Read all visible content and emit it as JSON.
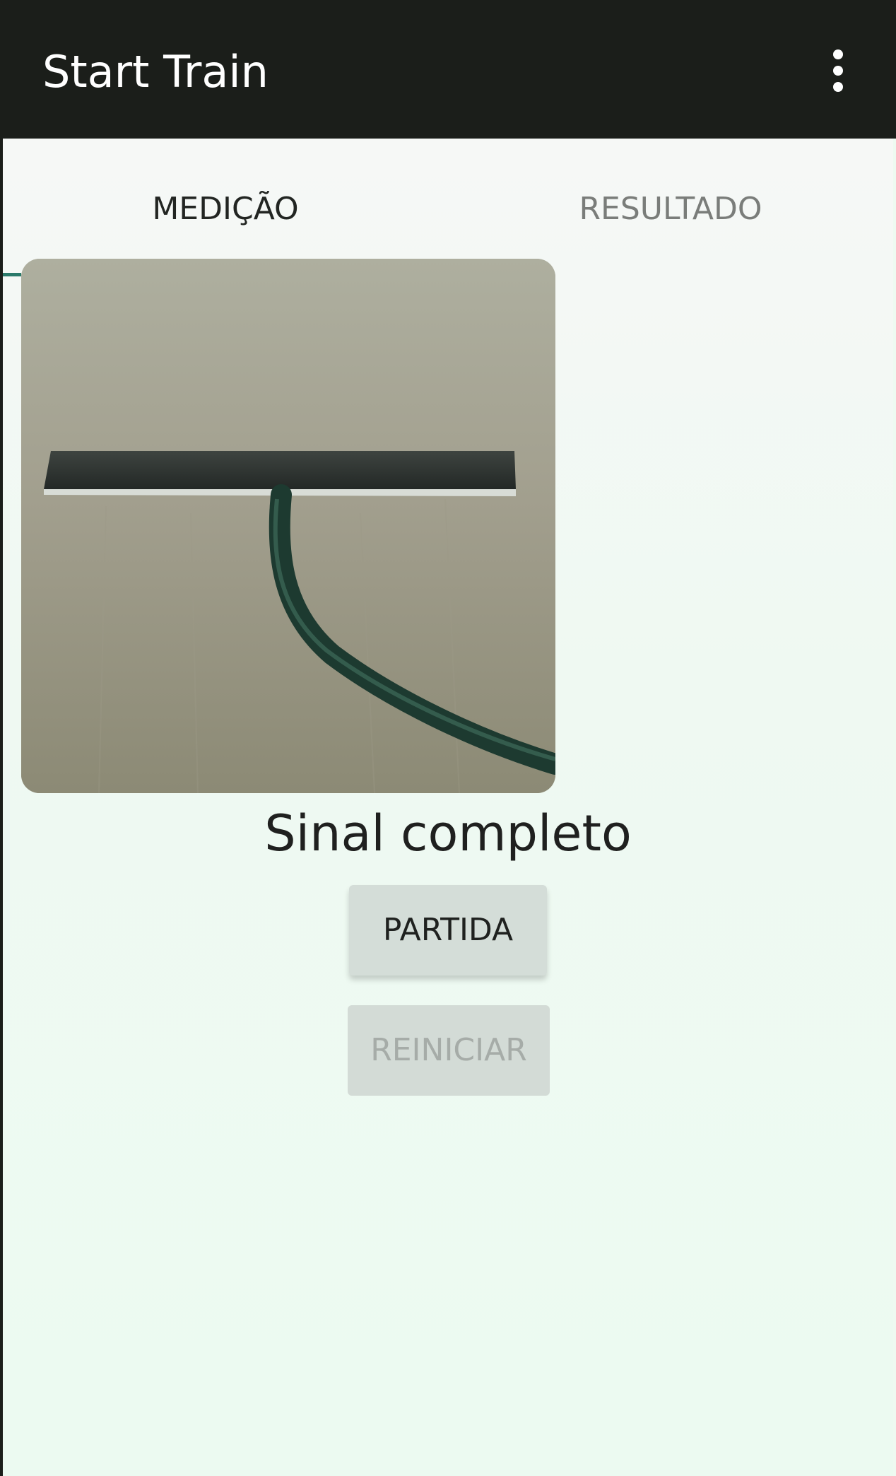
{
  "app_bar": {
    "title": "Start Train",
    "overflow_menu_icon": "more-vert-icon"
  },
  "tabs": [
    {
      "label": "MEDIÇÃO",
      "selected": true
    },
    {
      "label": "RESULTADO",
      "selected": false
    }
  ],
  "camera": {
    "subject": "camera-preview"
  },
  "status": {
    "text": "Sinal completo"
  },
  "buttons": {
    "start_label": "PARTIDA",
    "reset_label": "REINICIAR",
    "reset_enabled": false
  },
  "colors": {
    "app_bar": "#1b1e1a",
    "background": "#eefaf1",
    "indicator": "#2a7a6a",
    "button": "#d4ddd8"
  }
}
